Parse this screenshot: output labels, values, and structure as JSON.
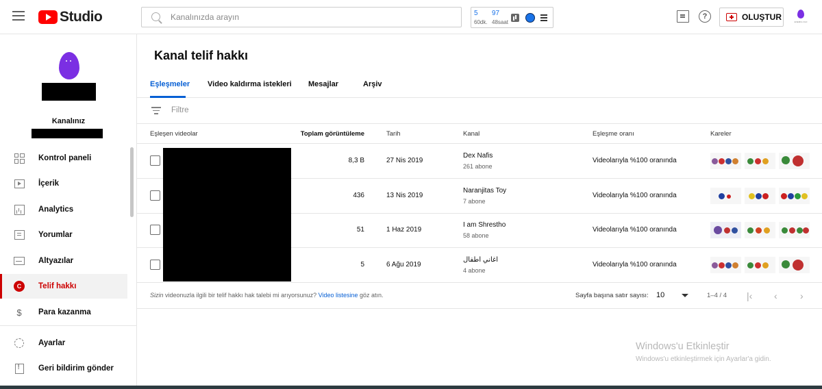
{
  "header": {
    "logo_text": "Studio",
    "search_placeholder": "Kanalınızda arayın",
    "ext": {
      "val1": "5",
      "sub1": "60dk.",
      "val2": "97",
      "sub2": "48saat"
    },
    "create_label": "OLUŞTUR",
    "avatar_text": "ENEMIG OLD"
  },
  "sidebar": {
    "channel_label": "Kanalınız",
    "items": [
      {
        "label": "Kontrol paneli",
        "icon": "dashboard-icon"
      },
      {
        "label": "İçerik",
        "icon": "content-icon"
      },
      {
        "label": "Analytics",
        "icon": "analytics-icon"
      },
      {
        "label": "Yorumlar",
        "icon": "comments-icon"
      },
      {
        "label": "Altyazılar",
        "icon": "subtitles-icon"
      },
      {
        "label": "Telif hakkı",
        "icon": "copyright-icon",
        "active": true
      },
      {
        "label": "Para kazanma",
        "icon": "dollar-icon"
      },
      {
        "label": "Ayarlar",
        "icon": "gear-icon"
      },
      {
        "label": "Geri bildirim gönder",
        "icon": "feedback-icon"
      }
    ]
  },
  "main": {
    "title": "Kanal telif hakkı",
    "tabs": [
      {
        "label": "Eşleşmeler",
        "active": true
      },
      {
        "label": "Video kaldırma istekleri"
      },
      {
        "label": "Mesajlar"
      },
      {
        "label": "Arşiv"
      }
    ],
    "filter_label": "Filtre",
    "columns": {
      "matched_videos": "Eşleşen videolar",
      "total_views": "Toplam görüntüleme",
      "date": "Tarih",
      "channel": "Kanal",
      "match_rate": "Eşleşme oranı",
      "frames": "Kareler"
    },
    "rows": [
      {
        "views": "8,3 B",
        "date": "27 Nis 2019",
        "channel": "Dex Nafis",
        "subs": "261 abone",
        "match": "Videolarıyla %100 oranında"
      },
      {
        "views": "436",
        "date": "13 Nis 2019",
        "channel": "Naranjitas Toy",
        "subs": "7 abone",
        "match": "Videolarıyla %100 oranında"
      },
      {
        "views": "51",
        "date": "1 Haz 2019",
        "channel": "I am Shrestho",
        "subs": "58 abone",
        "match": "Videolarıyla %100 oranında"
      },
      {
        "views": "5",
        "date": "6 Ağu 2019",
        "channel": "اغاني اطفال",
        "subs": "4 abone",
        "match": "Videolarıyla %100 oranında"
      }
    ],
    "footer": {
      "text_before": "Sizin",
      "text_middle": " videonuzla ilgili bir telif hakkı hak talebi mi arıyorsunuz? ",
      "link": "Video listesine",
      "text_after": " göz atın.",
      "per_page_label": "Sayfa başına satır sayısı:",
      "per_page_value": "10",
      "range": "1–4 / 4"
    }
  },
  "watermark": {
    "line1": "Windows'u Etkinleştir",
    "line2": "Windows'u etkinleştirmek için Ayarlar'a gidin."
  }
}
